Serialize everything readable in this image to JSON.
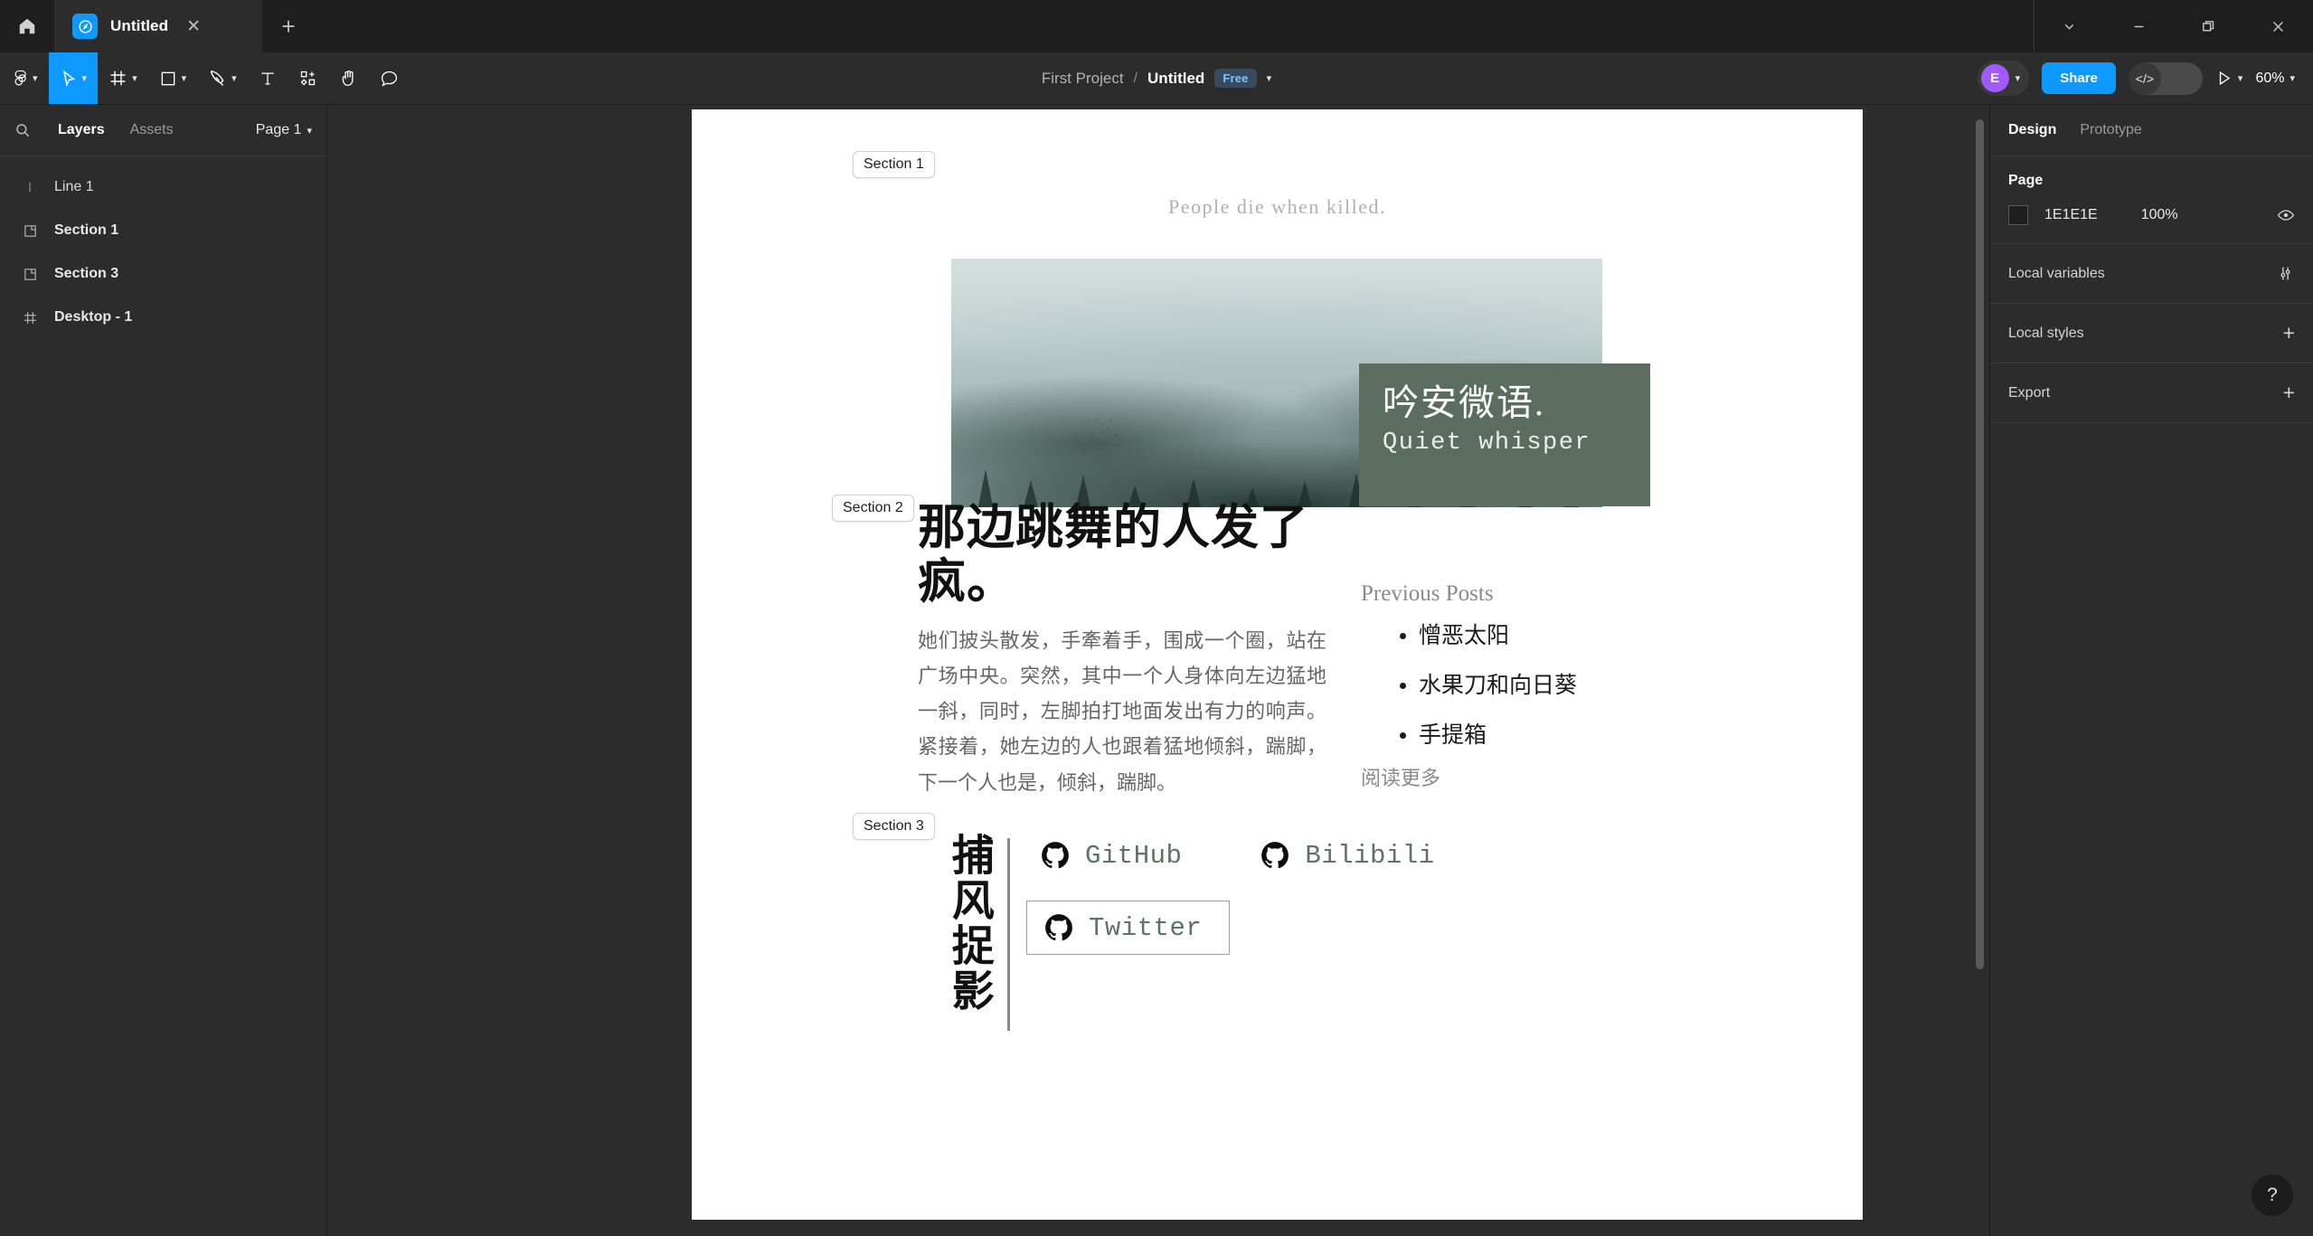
{
  "window": {
    "home_icon": "home-icon",
    "tab_title": "Untitled",
    "tab_close": "✕",
    "new_tab": "+",
    "controls": {
      "chevron": "chevron-down-icon",
      "minimize": "minimize-icon",
      "restore": "restore-icon",
      "close": "close-icon"
    }
  },
  "toolbar": {
    "tools": [
      {
        "name": "figma-menu",
        "icon": "figma-logo-icon",
        "caret": true,
        "active": false
      },
      {
        "name": "move",
        "icon": "cursor-icon",
        "caret": true,
        "active": true
      },
      {
        "name": "frame",
        "icon": "frame-icon",
        "caret": true,
        "active": false
      },
      {
        "name": "shape",
        "icon": "rectangle-icon",
        "caret": true,
        "active": false
      },
      {
        "name": "pen",
        "icon": "pen-icon",
        "caret": true,
        "active": false
      },
      {
        "name": "text",
        "icon": "text-icon",
        "caret": false,
        "active": false
      },
      {
        "name": "components",
        "icon": "components-icon",
        "caret": false,
        "active": false
      },
      {
        "name": "hand",
        "icon": "hand-icon",
        "caret": false,
        "active": false
      },
      {
        "name": "comment",
        "icon": "comment-icon",
        "caret": false,
        "active": false
      }
    ],
    "breadcrumb_project": "First Project",
    "breadcrumb_sep": "/",
    "breadcrumb_file": "Untitled",
    "plan_badge": "Free",
    "avatar_initial": "E",
    "share_label": "Share",
    "code_icon": "</>",
    "play_icon": "play-icon",
    "zoom_level": "60%",
    "accent_color": "#0D99FF",
    "avatar_color": "#A259FF"
  },
  "left_panel": {
    "search_icon": "search-icon",
    "tabs": [
      {
        "label": "Layers",
        "active": true
      },
      {
        "label": "Assets",
        "active": false
      }
    ],
    "page_selector": "Page 1",
    "layers": [
      {
        "name": "Line 1",
        "icon": "line-icon",
        "bold": false
      },
      {
        "name": "Section 1",
        "icon": "section-icon",
        "bold": true
      },
      {
        "name": "Section 3",
        "icon": "section-icon",
        "bold": true
      },
      {
        "name": "Desktop - 1",
        "icon": "frame-icon",
        "bold": true
      }
    ]
  },
  "canvas": {
    "section_badges": [
      {
        "label": "Section 1"
      },
      {
        "label": "Section 2"
      },
      {
        "label": "Section 3"
      }
    ],
    "quote": "People die when killed.",
    "hero_image_alt": "misty-forest-mountain-photo",
    "green_card": {
      "title_cn": "吟安微语.",
      "subtitle_en": "Quiet whisper",
      "bg_color": "#5B6D60"
    },
    "article": {
      "heading": "那边跳舞的人发了疯。",
      "body": "她们披头散发，手牽着手，围成一个圈，站在广场中央。突然，其中一个人身体向左边猛地一斜，同时，左脚拍打地面发出有力的响声。紧接着，她左边的人也跟着猛地倾斜，踹脚，下一个人也是，倾斜，踹脚。"
    },
    "previous_posts": {
      "title": "Previous Posts",
      "items": [
        "憎恶太阳",
        "水果刀和向日葵",
        "手提箱"
      ],
      "read_more": "阅读更多"
    },
    "footer": {
      "vertical_text": "捕风捉影",
      "links": [
        {
          "label": "GitHub",
          "icon": "github-icon",
          "boxed": false
        },
        {
          "label": "Bilibili",
          "icon": "github-icon",
          "boxed": false
        },
        {
          "label": "Twitter",
          "icon": "github-icon",
          "boxed": true
        }
      ],
      "link_color": "#5D7268"
    }
  },
  "right_panel": {
    "tabs": [
      {
        "label": "Design",
        "active": true
      },
      {
        "label": "Prototype",
        "active": false
      }
    ],
    "page_section": {
      "title": "Page",
      "color_hex": "1E1E1E",
      "opacity": "100%",
      "visibility_icon": "eye-icon"
    },
    "rows": [
      {
        "label": "Local variables",
        "action_icon": "sliders-icon",
        "action_glyph": ""
      },
      {
        "label": "Local styles",
        "action_icon": "plus-icon",
        "action_glyph": "+"
      },
      {
        "label": "Export",
        "action_icon": "plus-icon",
        "action_glyph": "+"
      }
    ]
  },
  "help": {
    "label": "?"
  }
}
